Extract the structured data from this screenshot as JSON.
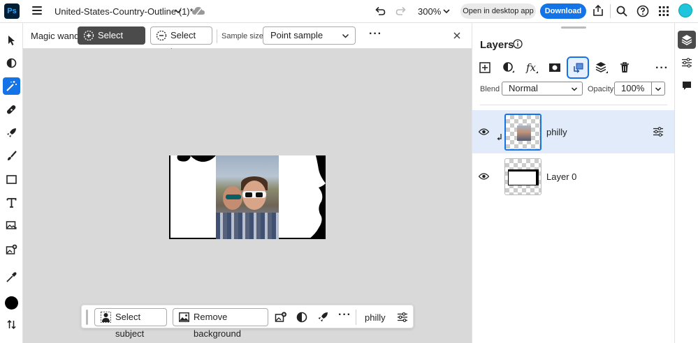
{
  "app": {
    "logo_text": "Ps"
  },
  "header": {
    "document_title": "United-States-Country-Outline (1)*",
    "zoom": "300%",
    "open_desktop_label": "Open in desktop app",
    "download_label": "Download"
  },
  "tool_options": {
    "tool_name": "Magic wand",
    "select_more_label": "Select more",
    "select_less_label": "Select less",
    "sample_size_label": "Sample size",
    "sample_size_value": "Point sample"
  },
  "taskbar": {
    "select_subject_label": "Select subject",
    "remove_background_label": "Remove background",
    "layer_name": "philly"
  },
  "layers_panel": {
    "title": "Layers",
    "blend_label": "Blend",
    "blend_value": "Normal",
    "opacity_label": "Opacity",
    "opacity_value": "100%",
    "layers": [
      {
        "name": "philly",
        "selected": true,
        "visible": true,
        "clipped": true
      },
      {
        "name": "Layer 0",
        "selected": false,
        "visible": true,
        "clipped": false
      }
    ]
  },
  "colors": {
    "accent": "#1473e6",
    "ps_logo_bg": "#001e36",
    "ps_logo_text": "#31a8ff",
    "canvas_bg": "#d9d9d9",
    "selected_layer_bg": "#e2ebf9",
    "avatar": "#20c4dc"
  },
  "left_tools": [
    "move-tool-icon",
    "adjust-icon",
    "magic-wand-icon",
    "healing-icon",
    "quick-action-icon",
    "brush-icon",
    "rectangle-icon",
    "type-icon",
    "image-add-icon",
    "generative-fill-icon",
    "eyedropper-icon",
    "foreground-color-icon",
    "swap-icon"
  ]
}
